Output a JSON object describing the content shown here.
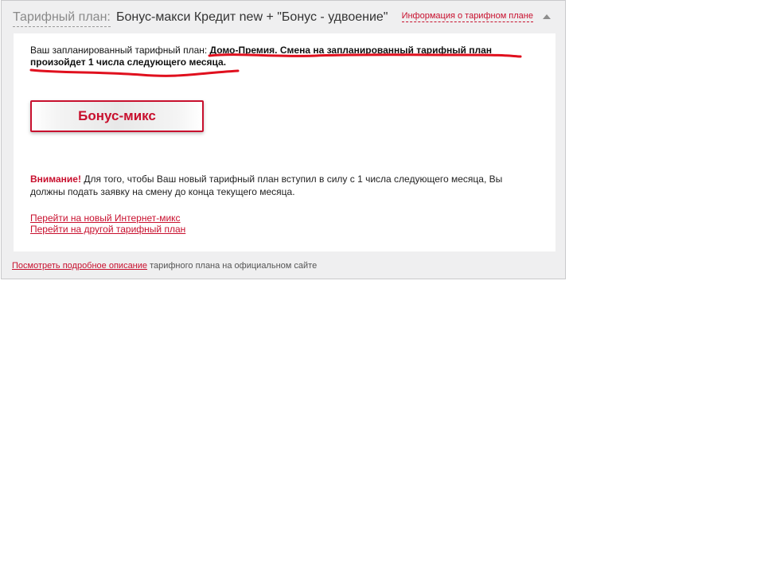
{
  "header": {
    "prefix": "Тарифный план:",
    "plan_name": "Бонус-макси Кредит new + \"Бонус - удвоение\"",
    "info_link": "Информация о тарифном плане"
  },
  "scheduled": {
    "label": "Ваш запланированный тарифный план: ",
    "highlight_line1": "Домо-Премия. Смена на запланированный тарифный план",
    "highlight_line2": "произойдет 1 числа следующего месяца."
  },
  "tariff_button": {
    "label": "Бонус-микс"
  },
  "warning": {
    "label": "Внимание!",
    "text": " Для того, чтобы Ваш новый тарифный план вступил в силу с 1 числа следующего месяца, Вы должны подать заявку на смену до конца текущего месяца."
  },
  "links": {
    "internet_mix": "Перейти на новый Интернет-микс",
    "other_plan": "Перейти на другой тарифный план"
  },
  "footer": {
    "link": "Посмотреть подробное описание",
    "text": " тарифного плана на официальном сайте"
  },
  "colors": {
    "accent": "#c8102e",
    "panel_bg": "#efeff0",
    "annotation": "#e0101e"
  }
}
